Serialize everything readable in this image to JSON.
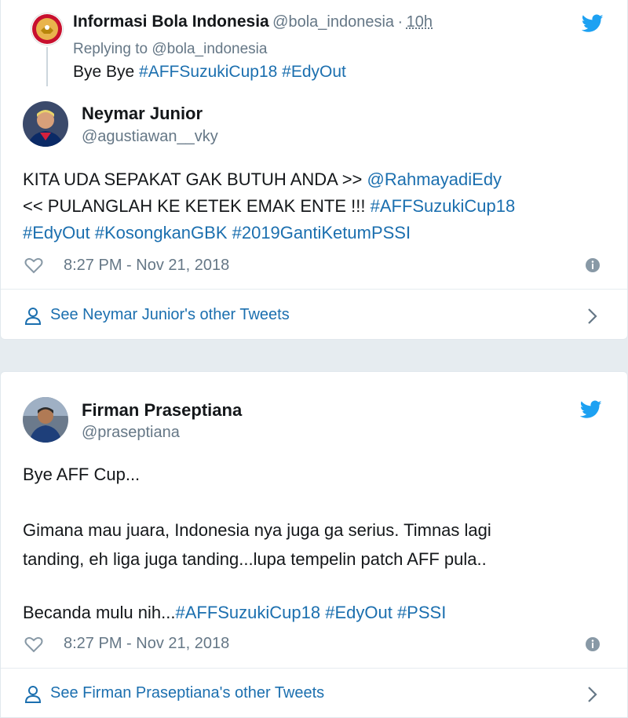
{
  "tweet1": {
    "parent": {
      "name": "Informasi Bola Indonesia",
      "handle": "@bola_indonesia",
      "dot": "·",
      "time": "10h",
      "replying": "Replying to @bola_indonesia",
      "text_prefix": "Bye Bye ",
      "hashtags": "#AFFSuzukiCup18 #EdyOut"
    },
    "author": {
      "name": "Neymar Junior",
      "handle": "@agustiawan__vky"
    },
    "lines": [
      {
        "text": "KITA UDA SEPAKAT GAK BUTUH ANDA  >> ",
        "link": "@RahmayadiEdy"
      },
      {
        "text": "<< PULANGLAH KE KETEK EMAK ENTE !!! ",
        "link": "#AFFSuzukiCup18"
      },
      {
        "text": "",
        "link": "#EdyOut #KosongkanGBK #2019GantiKetumPSSI"
      }
    ],
    "timestamp": "8:27 PM - Nov 21, 2018",
    "see_more": "See Neymar Junior's other Tweets"
  },
  "tweet2": {
    "author": {
      "name": "Firman Praseptiana",
      "handle": "@praseptiana"
    },
    "line1": "Bye AFF Cup...",
    "line2": "Gimana mau juara, Indonesia nya juga ga serius. Timnas lagi",
    "line3": "tanding, eh liga juga tanding...lupa tempelin patch AFF pula..",
    "line4_text": "Becanda mulu nih...",
    "line4_link": "#AFFSuzukiCup18 #EdyOut #PSSI",
    "timestamp": "8:27 PM - Nov 21, 2018",
    "see_more": "See Firman Praseptiana's other Tweets"
  },
  "icons": {
    "twitter": "twitter-bird-icon",
    "heart": "heart-icon",
    "info": "info-icon",
    "person": "person-icon",
    "chevron": "chevron-right-icon"
  },
  "colors": {
    "link": "#1b6faf",
    "twitter_blue": "#1da1f2",
    "muted": "#657786",
    "background": "#e6ecf0"
  }
}
